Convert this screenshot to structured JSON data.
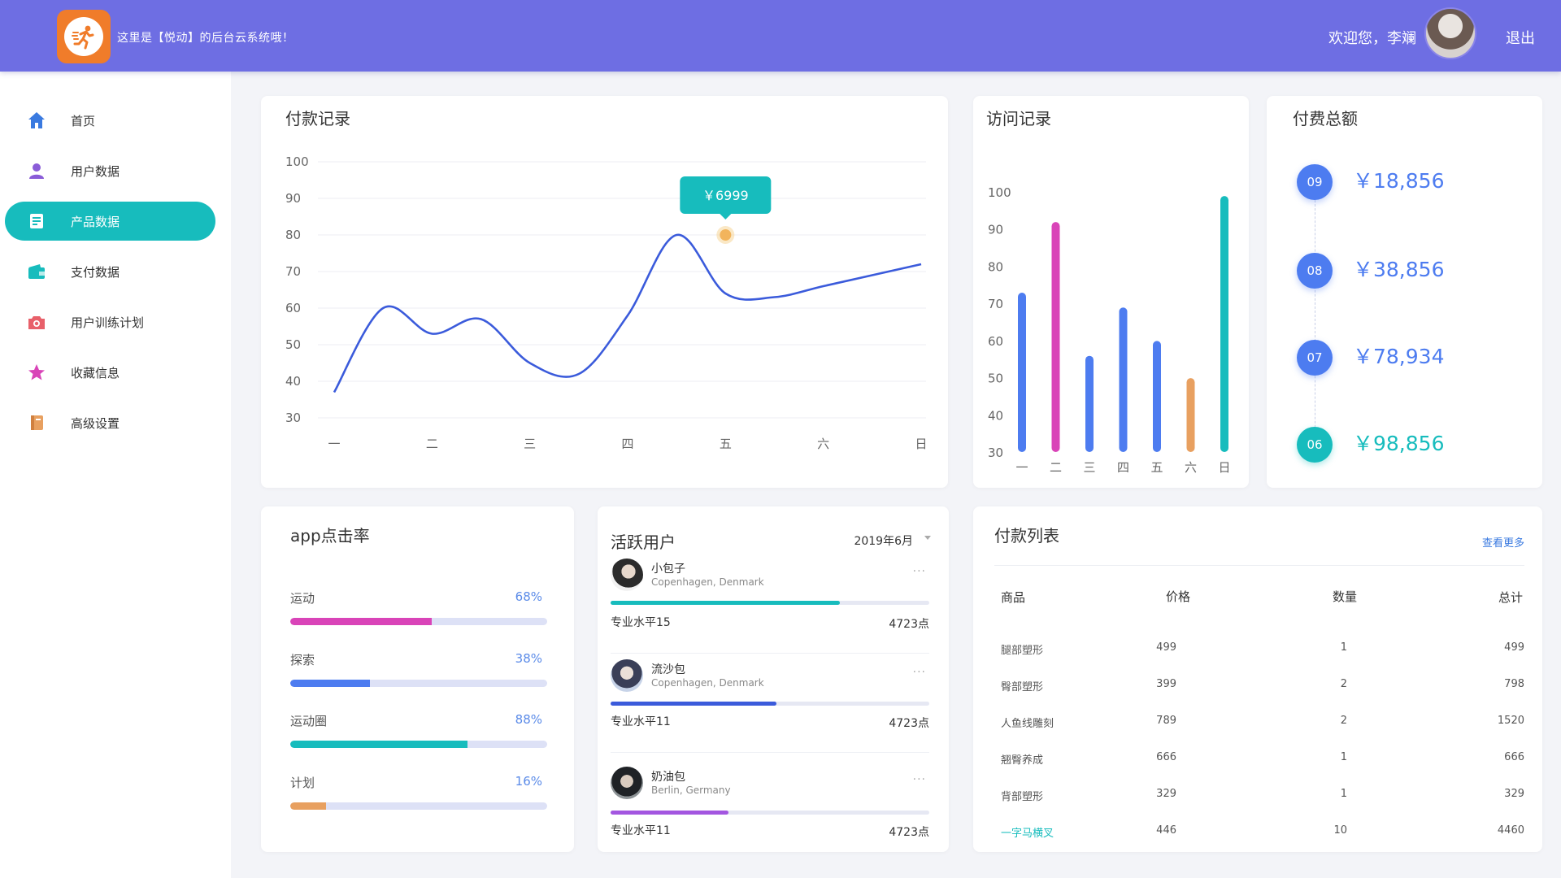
{
  "header": {
    "title": "这里是【悦动】的后台云系统哦！",
    "welcome": "欢迎您，李斓",
    "logout": "退出"
  },
  "sidebar": {
    "items": [
      {
        "label": "首页",
        "icon": "home-icon",
        "color": "#3a7ae0",
        "active": false
      },
      {
        "label": "用户数据",
        "icon": "user-icon",
        "color": "#8a5cd8",
        "active": false
      },
      {
        "label": "产品数据",
        "icon": "document-icon",
        "color": "#ffffff",
        "active": true
      },
      {
        "label": "支付数据",
        "icon": "wallet-icon",
        "color": "#17bcbd",
        "active": false
      },
      {
        "label": "用户训练计划",
        "icon": "camera-icon",
        "color": "#e8606a",
        "active": false
      },
      {
        "label": "收藏信息",
        "icon": "star-icon",
        "color": "#d944b8",
        "active": false
      },
      {
        "label": "高级设置",
        "icon": "book-icon",
        "color": "#e8a060",
        "active": false
      }
    ]
  },
  "payment_record": {
    "title": "付款记录",
    "tooltip": "￥6999",
    "chart_data": {
      "type": "line",
      "categories": [
        "一",
        "二",
        "三",
        "四",
        "五",
        "六",
        "日"
      ],
      "x": [
        0,
        0.5,
        1,
        1.5,
        2,
        2.5,
        3,
        3.5,
        4,
        4.5,
        5,
        5.5,
        6
      ],
      "values": [
        37,
        60,
        53,
        57,
        45,
        42,
        58,
        80,
        64,
        63,
        66,
        69,
        72
      ],
      "ylim": [
        30,
        100
      ],
      "yticks": [
        100,
        90,
        80,
        70,
        60,
        50,
        40,
        30
      ],
      "highlight": {
        "x": 4,
        "y": 80,
        "label": "￥6999"
      },
      "color": "#3b5bdb",
      "grid": true
    }
  },
  "visit_record": {
    "title": "访问记录",
    "chart_data": {
      "type": "bar",
      "categories": [
        "一",
        "二",
        "三",
        "四",
        "五",
        "六",
        "日"
      ],
      "values": [
        72,
        91,
        55,
        68,
        59,
        49,
        98
      ],
      "colors": [
        "#4d7cf0",
        "#d944b8",
        "#4d7cf0",
        "#4d7cf0",
        "#4d7cf0",
        "#e8a060",
        "#17bcbd"
      ],
      "ylim": [
        30,
        100
      ],
      "yticks": [
        100,
        90,
        80,
        70,
        60,
        50,
        40,
        30
      ]
    }
  },
  "total_paid": {
    "title": "付费总额",
    "items": [
      {
        "month": "09",
        "amount": "￥18,856",
        "color": "#4d7cf0"
      },
      {
        "month": "08",
        "amount": "￥38,856",
        "color": "#4d7cf0"
      },
      {
        "month": "07",
        "amount": "￥78,934",
        "color": "#4d7cf0"
      },
      {
        "month": "06",
        "amount": "￥98,856",
        "color": "#17bcbd"
      }
    ]
  },
  "app_click_rate": {
    "title": "app点击率",
    "items": [
      {
        "label": "运动",
        "pct": "68%",
        "fill": 0.55,
        "color": "#d944b8"
      },
      {
        "label": "探索",
        "pct": "38%",
        "fill": 0.31,
        "color": "#4d7cf0"
      },
      {
        "label": "运动圈",
        "pct": "88%",
        "fill": 0.69,
        "color": "#17bcbd"
      },
      {
        "label": "计划",
        "pct": "16%",
        "fill": 0.14,
        "color": "#e8a060"
      }
    ]
  },
  "active_users": {
    "title": "活跃用户",
    "period": "2019年6月",
    "users": [
      {
        "name": "小包子",
        "location": "Copenhagen, Denmark",
        "level": "专业水平15",
        "points": "4723点",
        "progress": 0.72,
        "color": "#17bcbd"
      },
      {
        "name": "流沙包",
        "location": "Copenhagen, Denmark",
        "level": "专业水平11",
        "points": "4723点",
        "progress": 0.52,
        "color": "#3b5bdb"
      },
      {
        "name": "奶油包",
        "location": "Berlin, Germany",
        "level": "专业水平11",
        "points": "4723点",
        "progress": 0.37,
        "color": "#a356e0"
      }
    ]
  },
  "payment_list": {
    "title": "付款列表",
    "see_more": "查看更多",
    "columns": [
      "商品",
      "价格",
      "数量",
      "总计"
    ],
    "rows": [
      [
        "腿部塑形",
        "499",
        "1",
        "499"
      ],
      [
        "臀部塑形",
        "399",
        "2",
        "798"
      ],
      [
        "人鱼线雕刻",
        "789",
        "2",
        "1520"
      ],
      [
        "翘臀养成",
        "666",
        "1",
        "666"
      ],
      [
        "背部塑形",
        "329",
        "1",
        "329"
      ],
      [
        "一字马横叉",
        "446",
        "10",
        "4460"
      ]
    ],
    "highlight_color": "#17bcbd"
  }
}
